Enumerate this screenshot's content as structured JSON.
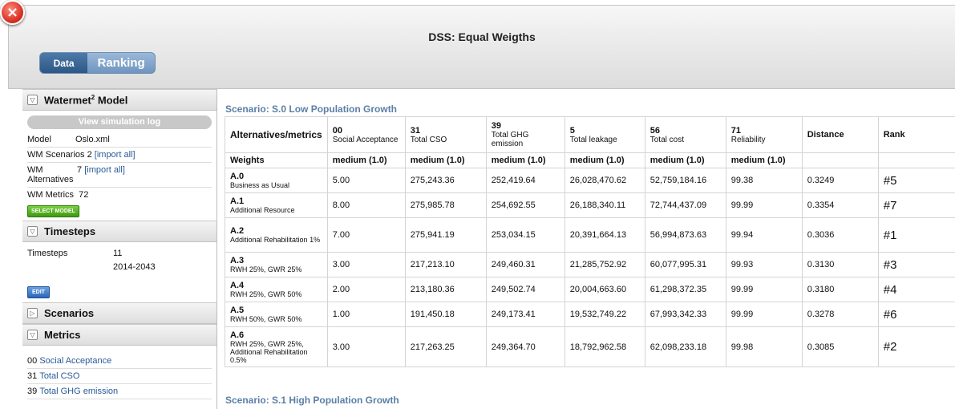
{
  "window": {
    "title": "DSS: Equal Weigths"
  },
  "tabs": [
    {
      "label": "Data"
    },
    {
      "label": "Ranking"
    }
  ],
  "sidebar": {
    "model_section": {
      "title_prefix": "Watermet",
      "title_sup": "2",
      "title_suffix": " Model"
    },
    "view_log": "View simulation log",
    "model": {
      "label": "Model",
      "value": "Oslo.xml"
    },
    "scenarios": {
      "label": "WM Scenarios",
      "count": "2",
      "import": "[import all]"
    },
    "alternatives": {
      "label": "WM Alternatives",
      "count": "7",
      "import": "[import all]"
    },
    "metrics": {
      "label": "WM Metrics",
      "count": "72"
    },
    "select_model": "SELECT MODEL",
    "timesteps_title": "Timesteps",
    "timesteps": {
      "label": "Timesteps",
      "count": "11",
      "range": "2014-2043"
    },
    "edit": "EDIT",
    "scenarios_title": "Scenarios",
    "metrics_title": "Metrics",
    "metric_items": [
      {
        "code": "00",
        "name": "Social Acceptance"
      },
      {
        "code": "31",
        "name": "Total CSO"
      },
      {
        "code": "39",
        "name": "Total GHG emission"
      }
    ]
  },
  "main": {
    "scenario0": "Scenario: S.0 Low Population Growth",
    "scenario1": "Scenario: S.1 High Population Growth",
    "headers": {
      "alt": "Alternatives/metrics",
      "metrics": [
        {
          "code": "00",
          "name": "Social Acceptance"
        },
        {
          "code": "31",
          "name": "Total CSO"
        },
        {
          "code": "39",
          "name": "Total GHG emission"
        },
        {
          "code": "5",
          "name": "Total leakage"
        },
        {
          "code": "56",
          "name": "Total cost"
        },
        {
          "code": "71",
          "name": "Reliability"
        }
      ],
      "distance": "Distance",
      "rank": "Rank"
    },
    "weights": {
      "label": "Weights",
      "values": [
        "medium (1.0)",
        "medium (1.0)",
        "medium (1.0)",
        "medium (1.0)",
        "medium (1.0)",
        "medium (1.0)"
      ]
    },
    "rows": [
      {
        "id": "A.0",
        "name": "Business as Usual",
        "values": [
          "5.00",
          "275,243.36",
          "252,419.64",
          "26,028,470.62",
          "52,759,184.16",
          "99.38"
        ],
        "distance": "0.3249",
        "rank": "#5"
      },
      {
        "id": "A.1",
        "name": "Additional Resource",
        "values": [
          "8.00",
          "275,985.78",
          "254,692.55",
          "26,188,340.11",
          "72,744,437.09",
          "99.99"
        ],
        "distance": "0.3354",
        "rank": "#7"
      },
      {
        "id": "A.2",
        "name": "Additional Rehabilitation 1%",
        "values": [
          "7.00",
          "275,941.19",
          "253,034.15",
          "20,391,664.13",
          "56,994,873.63",
          "99.94"
        ],
        "distance": "0.3036",
        "rank": "#1"
      },
      {
        "id": "A.3",
        "name": "RWH 25%, GWR 25%",
        "values": [
          "3.00",
          "217,213.10",
          "249,460.31",
          "21,285,752.92",
          "60,077,995.31",
          "99.93"
        ],
        "distance": "0.3130",
        "rank": "#3"
      },
      {
        "id": "A.4",
        "name": "RWH 25%, GWR 50%",
        "values": [
          "2.00",
          "213,180.36",
          "249,502.74",
          "20,004,663.60",
          "61,298,372.35",
          "99.99"
        ],
        "distance": "0.3180",
        "rank": "#4"
      },
      {
        "id": "A.5",
        "name": "RWH 50%, GWR 50%",
        "values": [
          "1.00",
          "191,450.18",
          "249,173.41",
          "19,532,749.22",
          "67,993,342.33",
          "99.99"
        ],
        "distance": "0.3278",
        "rank": "#6"
      },
      {
        "id": "A.6",
        "name": "RWH 25%, GWR 25%, Additional Rehabilitation 0.5%",
        "values": [
          "3.00",
          "217,263.25",
          "249,364.70",
          "18,792,962.58",
          "62,098,233.18",
          "99.98"
        ],
        "distance": "0.3085",
        "rank": "#2"
      }
    ]
  }
}
